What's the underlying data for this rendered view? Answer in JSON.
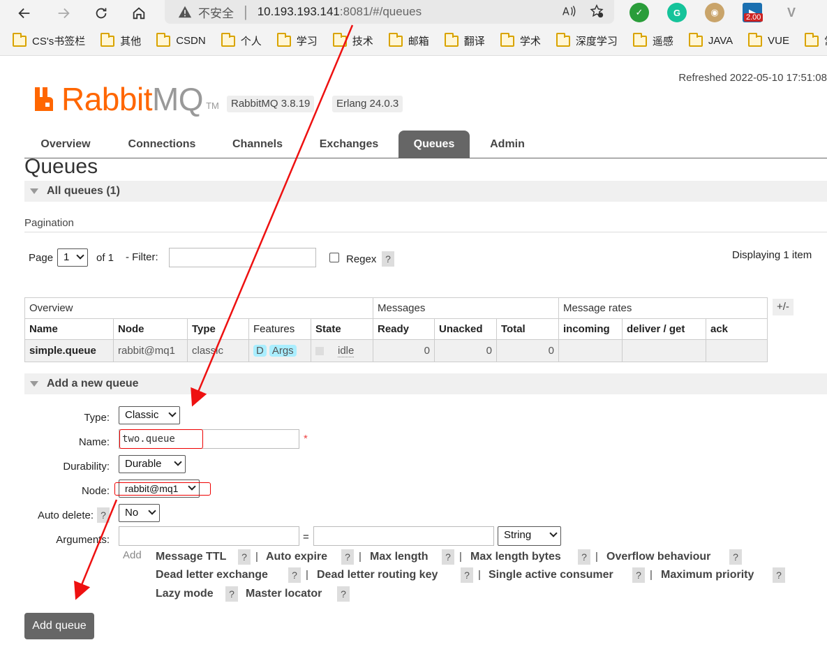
{
  "browser": {
    "insecure_label": "不安全",
    "url_host": "10.193.193.141",
    "url_path": ":8081/#/queues",
    "ext_badge": "2.00",
    "bookmarks": [
      "CS's书签栏",
      "其他",
      "CSDN",
      "个人",
      "学习",
      "技术",
      "邮箱",
      "翻译",
      "学术",
      "深度学习",
      "遥感",
      "JAVA",
      "VUE",
      "常"
    ]
  },
  "header": {
    "logo_rabbit": "Rabbit",
    "logo_mq": "MQ",
    "logo_tm": "TM",
    "version_rabbit": "RabbitMQ 3.8.19",
    "version_erlang": "Erlang 24.0.3",
    "refreshed": "Refreshed 2022-05-10 17:51:08"
  },
  "tabs": [
    "Overview",
    "Connections",
    "Channels",
    "Exchanges",
    "Queues",
    "Admin"
  ],
  "active_tab": "Queues",
  "page_title": "Queues",
  "all_queues": {
    "title": "All queues (1)",
    "pagination_label": "Pagination",
    "page_label": "Page",
    "page_value": "1",
    "of_label": "of 1",
    "filter_label": "- Filter:",
    "regex_label": "Regex",
    "help": "?",
    "displaying": "Displaying 1 item",
    "plus_minus": "+/-"
  },
  "table": {
    "groups": [
      "Overview",
      "Messages",
      "Message rates"
    ],
    "columns": [
      "Name",
      "Node",
      "Type",
      "Features",
      "State",
      "Ready",
      "Unacked",
      "Total",
      "incoming",
      "deliver / get",
      "ack"
    ],
    "row": {
      "name": "simple.queue",
      "node": "rabbit@mq1",
      "type": "classic",
      "features": [
        "D",
        "Args"
      ],
      "state": "idle",
      "ready": "0",
      "unacked": "0",
      "total": "0"
    }
  },
  "add_queue": {
    "title": "Add a new queue",
    "type_label": "Type:",
    "type_value": "Classic",
    "name_label": "Name:",
    "name_value": "two.queue",
    "required_mark": "*",
    "durability_label": "Durability:",
    "durability_value": "Durable",
    "node_label": "Node:",
    "node_value": "rabbit@mq1",
    "auto_delete_label": "Auto delete:",
    "auto_delete_value": "No",
    "arguments_label": "Arguments:",
    "equals": "=",
    "arg_type_value": "String",
    "add_label": "Add",
    "arg_links": [
      "Message TTL",
      "Auto expire",
      "Max length",
      "Max length bytes",
      "Overflow behaviour",
      "Dead letter exchange",
      "Dead letter routing key",
      "Single active consumer",
      "Maximum priority",
      "Lazy mode",
      "Master locator"
    ],
    "submit_label": "Add queue"
  },
  "colors": {
    "brand_orange": "#ff6600",
    "tab_active": "#666666",
    "annotation_red": "#ee1111"
  }
}
